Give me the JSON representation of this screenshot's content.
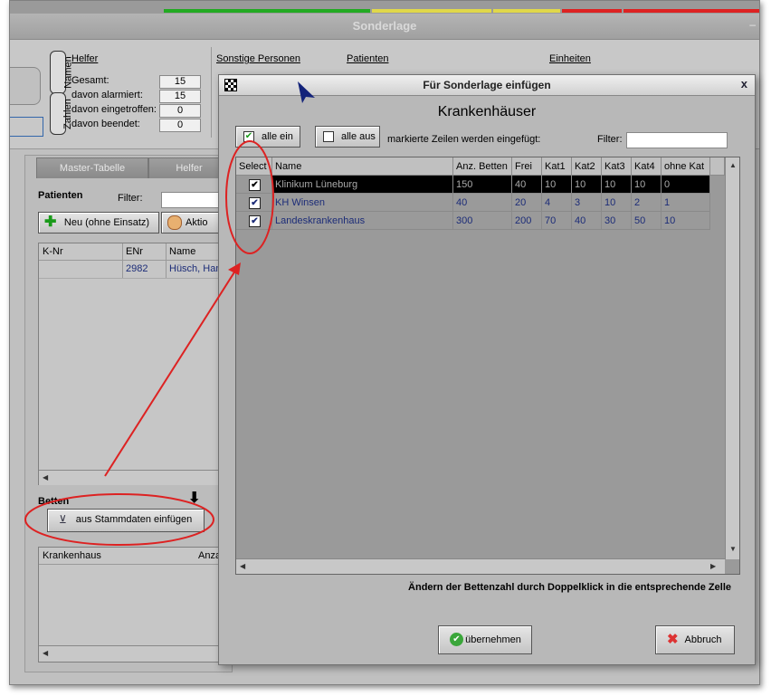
{
  "app": {
    "title": "Sonderlage",
    "title_dash": "–",
    "top_colors": [
      "#22aa22",
      "#e0d84a",
      "#e0d84a",
      "#dd2222",
      "#dd2222"
    ]
  },
  "stats": {
    "vtab_namen": "Namen",
    "vtab_zahlen": "Zahlen",
    "helfer_title": "Helfer",
    "rows": [
      {
        "label": "Gesamt:",
        "value": "15"
      },
      {
        "label": "davon alarmiert:",
        "value": "15"
      },
      {
        "label": "davon eingetroffen:",
        "value": "0"
      },
      {
        "label": "davon beendet:",
        "value": "0"
      }
    ],
    "col_headers": [
      "Sonstige Personen",
      "Patienten",
      "Einheiten"
    ]
  },
  "left": {
    "tabs": [
      "Master-Tabelle",
      "Helfer"
    ],
    "patients_title": "Patienten",
    "filter_label": "Filter:",
    "new_button": "Neu (ohne Einsatz)",
    "action_button": "Aktio",
    "grid_headers": [
      "K-Nr",
      "ENr",
      "Name"
    ],
    "grid_row": {
      "knr": "",
      "enr": "2982",
      "name": "Hüsch, Han"
    },
    "betten_title": "Betten",
    "stammdaten_button": "aus Stammdaten einfügen",
    "bed_headers": [
      "Krankenhaus",
      "Anza"
    ]
  },
  "dialog": {
    "title": "Für Sonderlage einfügen",
    "close": "x",
    "heading": "Krankenhäuser",
    "btn_all_on": "alle ein",
    "btn_all_off": "alle aus",
    "hint": "markierte Zeilen werden eingefügt:",
    "filter_label": "Filter:",
    "filter_value": "",
    "columns": [
      "Select",
      "Name",
      "Anz. Betten",
      "Frei",
      "Kat1",
      "Kat2",
      "Kat3",
      "Kat4",
      "ohne Kat"
    ],
    "rows": [
      {
        "selected": true,
        "name": "Klinikum Lüneburg",
        "anz": "150",
        "frei": "40",
        "k1": "10",
        "k2": "10",
        "k3": "10",
        "k4": "10",
        "ohne": "0"
      },
      {
        "selected": true,
        "name": "KH Winsen",
        "anz": "40",
        "frei": "20",
        "k1": "4",
        "k2": "3",
        "k3": "10",
        "k4": "2",
        "ohne": "1"
      },
      {
        "selected": true,
        "name": "Landeskrankenhaus",
        "anz": "300",
        "frei": "200",
        "k1": "70",
        "k2": "40",
        "k3": "30",
        "k4": "50",
        "ohne": "10"
      }
    ],
    "check_mark": "✔",
    "footer_note": "Ändern der Bettenzahl durch Doppelklick in die entsprechende Zelle",
    "btn_accept": "übernehmen",
    "btn_cancel": "Abbruch"
  }
}
